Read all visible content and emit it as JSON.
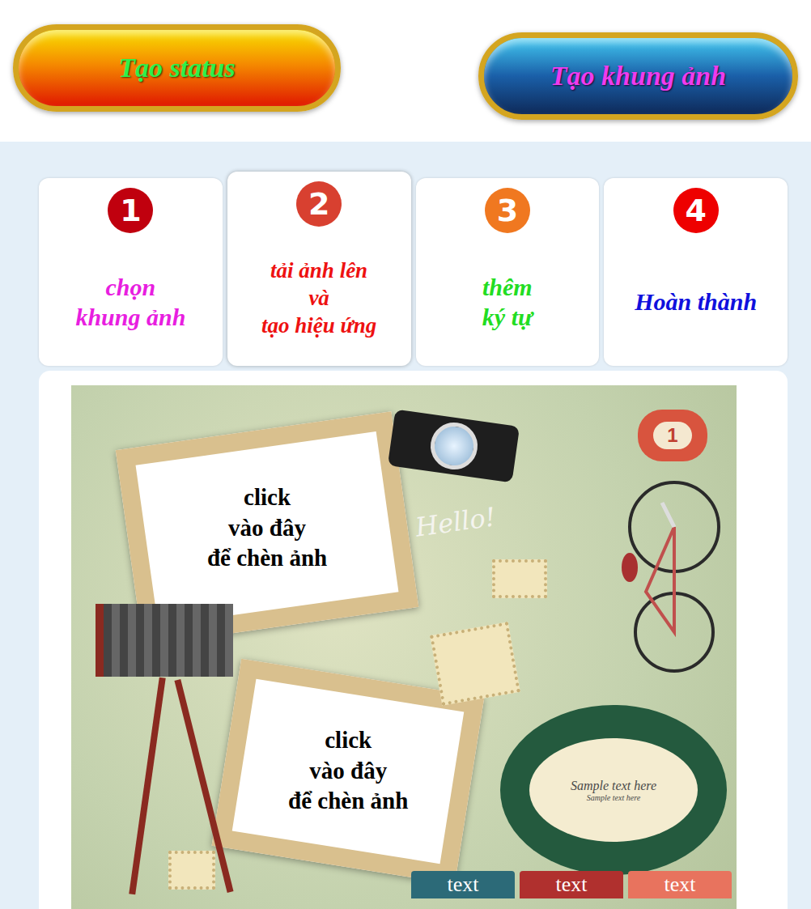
{
  "buttons": [
    {
      "label": "Tạo status",
      "kind": "orange"
    },
    {
      "label": "Tạo khung ảnh",
      "kind": "blue"
    }
  ],
  "steps": [
    {
      "number": "1",
      "lines": [
        "chọn",
        "khung ảnh"
      ],
      "color": "#e81ee0",
      "badge_color": "#c0000e",
      "selected": false
    },
    {
      "number": "2",
      "lines": [
        "tải ảnh lên",
        "và",
        "tạo hiệu ứng"
      ],
      "color": "#ee1111",
      "badge_color": "#d84030",
      "selected": true
    },
    {
      "number": "3",
      "lines": [
        "thêm",
        "ký tự"
      ],
      "color": "#22dd22",
      "badge_color": "#f07820",
      "selected": false
    },
    {
      "number": "4",
      "lines": [
        "Hoàn thành"
      ],
      "color": "#1010dd",
      "badge_color": "#ee0000",
      "selected": false
    }
  ],
  "editor": {
    "placeholders": [
      {
        "lines": [
          "click",
          "vào đây",
          "để chèn ảnh"
        ]
      },
      {
        "lines": [
          "click",
          "vào đây",
          "để chèn ảnh"
        ]
      }
    ],
    "greeting": "Hello!",
    "badge": "1",
    "bubble": {
      "title": "Sample text here",
      "subtitle": "Sample text here"
    },
    "tags": [
      {
        "label": "text",
        "color": "#2c6a78"
      },
      {
        "label": "text",
        "color": "#b0302e"
      },
      {
        "label": "text",
        "color": "#e8735e"
      }
    ]
  }
}
